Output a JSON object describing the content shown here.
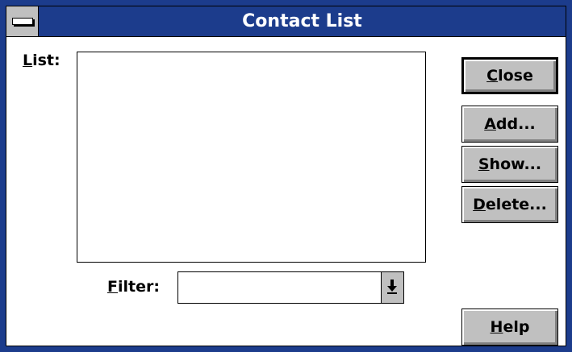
{
  "window": {
    "title": "Contact List",
    "colors": {
      "title_bar": "#1c3c8c",
      "button_face": "#c0c0c0",
      "background": "#ffffff"
    },
    "system_menu_icon": "system-menu-icon"
  },
  "list": {
    "label_accel": "L",
    "label_rest": "ist:",
    "items": []
  },
  "filter": {
    "label_accel": "F",
    "label_rest": "ilter:",
    "value": "",
    "dropdown_icon": "dropdown-arrow-icon"
  },
  "buttons": {
    "close": {
      "accel": "C",
      "rest": "lose"
    },
    "add": {
      "accel": "A",
      "rest": "dd..."
    },
    "show": {
      "accel": "S",
      "rest": "how..."
    },
    "delete": {
      "accel": "D",
      "rest": "elete..."
    },
    "help": {
      "accel": "H",
      "rest": "elp"
    }
  }
}
